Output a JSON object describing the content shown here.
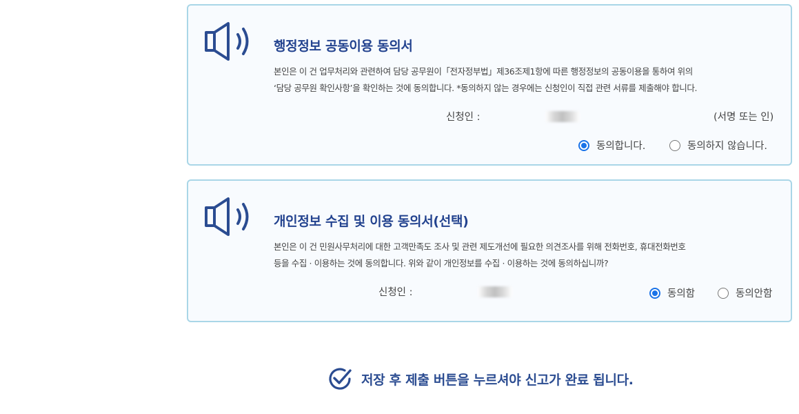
{
  "panel1": {
    "icon": "speaker-icon",
    "title": "행정정보 공동이용 동의서",
    "body_line1": "본인은 이 건 업무처리와 관련하여 담당 공무원이「전자정부법」제36조제1항에 따른 행정정보의 공동이용을 통하여 위의",
    "body_line2": "‘담당 공무원 확인사항’을 확인하는 것에 동의합니다. *동의하지 않는 경우에는 신청인이 직접 관련 서류를 제출해야 합니다.",
    "applicant_label": "신청인 :",
    "signature_hint": "(서명 또는 인)",
    "options": [
      {
        "label": "동의합니다.",
        "checked": true
      },
      {
        "label": "동의하지 않습니다.",
        "checked": false
      }
    ]
  },
  "panel2": {
    "icon": "speaker-icon",
    "title": "개인정보 수집 및 이용 동의서(선택)",
    "body_line1": "본인은 이 건 민원사무처리에 대한 고객만족도 조사 및 관련 제도개선에 필요한 의견조사를 위해 전화번호, 휴대전화번호",
    "body_line2": "등을 수집 · 이용하는 것에 동의합니다. 위와 같이 개인정보를 수집 · 이용하는 것에 동의하십니까?",
    "applicant_label": "신청인 :",
    "options": [
      {
        "label": "동의함",
        "checked": true
      },
      {
        "label": "동의안함",
        "checked": false
      }
    ]
  },
  "notice": {
    "icon": "check-circle-icon",
    "text": "저장 후 제출 버튼을 누르셔야 신고가 완료 됩니다."
  },
  "colors": {
    "title": "#23438f",
    "panel_border": "#a9d6e7",
    "panel_bg": "#f8fbfe",
    "radio_accent": "#1a73e8"
  }
}
